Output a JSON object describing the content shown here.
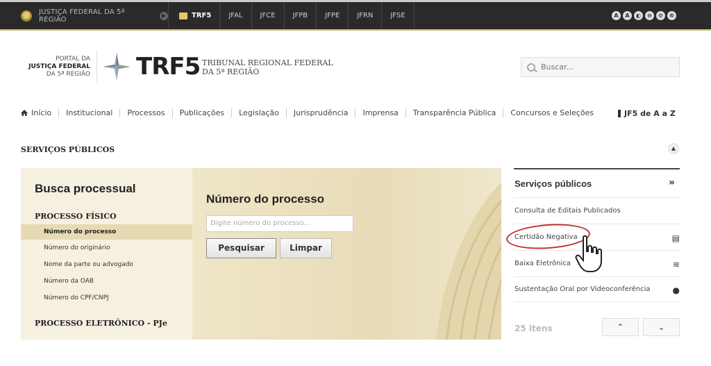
{
  "topbar": {
    "jf5_label": "JUSTIÇA FEDERAL DA 5ª REGIÃO",
    "tabs": [
      "TRF5",
      "JFAL",
      "JFCE",
      "JFPB",
      "JFPE",
      "JFRN",
      "JFSE"
    ],
    "accessibility_icons": [
      "A",
      "A",
      "◐",
      "⊖",
      "⚙",
      "®"
    ]
  },
  "header": {
    "portal_line1": "PORTAL DA",
    "portal_line2": "JUSTIÇA FEDERAL",
    "portal_line3": "DA 5ª REGIÃO",
    "logo": "TRF5",
    "subtitle_line1": "TRIBUNAL REGIONAL FEDERAL",
    "subtitle_line2": "DA 5ª REGIÃO",
    "search_placeholder": "Buscar..."
  },
  "nav": {
    "items": [
      "Início",
      "Institucional",
      "Processos",
      "Publicações",
      "Legislação",
      "Jurisprudência",
      "Imprensa",
      "Transparência Pública",
      "Concursos e Seleções"
    ],
    "jf5_az": "JF5 de A a Z"
  },
  "section": {
    "title": "SERVIÇOS PÚBLICOS"
  },
  "busca": {
    "title": "Busca processual",
    "fisico_heading": "PROCESSO FÍSICO",
    "links": [
      "Número do processo",
      "Número do originário",
      "Nome da parte ou advogado",
      "Número da OAB",
      "Número do CPF/CNPJ"
    ],
    "eletronico_heading": "PROCESSO ELETRÔNICO - PJe"
  },
  "form": {
    "title": "Número do processo",
    "placeholder": "Digite número do processo...",
    "search_button": "Pesquisar",
    "clear_button": "Limpar"
  },
  "sidebar": {
    "title": "Serviços públicos",
    "items": [
      {
        "label": "Consulta de Editais Publicados",
        "icon": ""
      },
      {
        "label": "Certidão Negativa",
        "icon": "document-icon"
      },
      {
        "label": "Baixa Eletrônica",
        "icon": "layers-icon"
      },
      {
        "label": "Sustentação Oral por Videoconferência",
        "icon": "user-icon"
      }
    ],
    "count": "25 itens"
  },
  "colors": {
    "topbar": "#2a2a2a",
    "panel_bg": "#e9dfc0",
    "highlight": "#c0302b"
  }
}
